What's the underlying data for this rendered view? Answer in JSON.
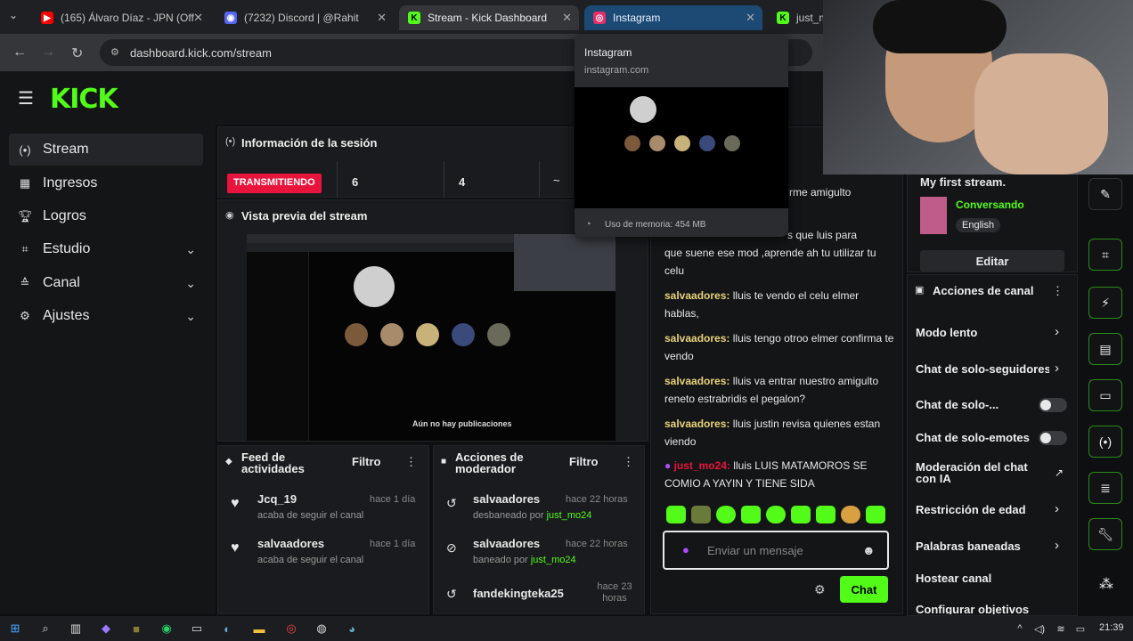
{
  "browser": {
    "tabs": [
      {
        "title": "(165) Álvaro Díaz - JPN (Off",
        "fav_color": "#ff0000"
      },
      {
        "title": "(7232) Discord | @Rahit",
        "fav_color": "#5865f2"
      },
      {
        "title": "Stream - Kick Dashboard",
        "fav_color": "#53fc18",
        "fav_letter": "K"
      },
      {
        "title": "Instagram",
        "fav_color": "#e1306c"
      },
      {
        "title": "just_m",
        "fav_color": "#53fc18",
        "fav_letter": "K"
      }
    ],
    "url": "dashboard.kick.com/stream",
    "hover_card": {
      "title": "Instagram",
      "domain": "instagram.com",
      "memory": "Uso de memoria: 454 MB"
    }
  },
  "header": {
    "logo": "KICK"
  },
  "sidebar": {
    "items": [
      {
        "label": "Stream",
        "icon": "stream-icon"
      },
      {
        "label": "Ingresos",
        "icon": "income-icon"
      },
      {
        "label": "Logros",
        "icon": "trophy-icon"
      },
      {
        "label": "Estudio",
        "icon": "studio-icon"
      },
      {
        "label": "Canal",
        "icon": "channel-icon"
      },
      {
        "label": "Ajustes",
        "icon": "settings-icon"
      }
    ]
  },
  "session": {
    "title": "Información de la sesión",
    "status": "TRANSMITIENDO",
    "stat1": "6",
    "stat2": "4",
    "stat3": "~"
  },
  "preview": {
    "title": "Vista previa del stream",
    "caption": "Aún no hay publicaciones"
  },
  "activity": {
    "title": "Feed de actividades",
    "filter": "Filtro",
    "events": [
      {
        "name": "Jcq_19",
        "sub": "acaba de seguir el canal",
        "time": "hace 1 día"
      },
      {
        "name": "salvaadores",
        "sub": "acaba de seguir el canal",
        "time": "hace 1 día"
      }
    ]
  },
  "moderator": {
    "title": "Acciones de moderador",
    "filter": "Filtro",
    "events": [
      {
        "name": "salvaadores",
        "action": "desbaneado por",
        "by": "just_mo24",
        "time": "hace 22 horas"
      },
      {
        "name": "salvaadores",
        "action": "baneado por",
        "by": "just_mo24",
        "time": "hace 22 horas"
      },
      {
        "name": "fandekingteka25",
        "time": "hace 23 horas"
      }
    ]
  },
  "chat": {
    "partial1": "rme amigulto",
    "partial2": "s que luis para",
    "partial3": "que suene ese mod ,aprende ah tu utilizar tu celu",
    "messages": [
      {
        "user": "salvaadores:",
        "text": "lluis te vendo el celu elmer hablas,"
      },
      {
        "user": "salvaadores:",
        "text": "lluis tengo otroo elmer confirma te vendo"
      },
      {
        "user": "salvaadores:",
        "text": "lluis va entrar nuestro amigulto reneto estrabridis el pegalon?"
      },
      {
        "user": "salvaadores:",
        "text": "lluis justin revisa quienes estan viendo"
      }
    ],
    "mod_msg": {
      "user": "just_mo24:",
      "text": "lluis LUIS MATAMOROS SE COMIO A YAYIN Y TIENE SIDA"
    },
    "placeholder": "Enviar un mensaje",
    "send": "Chat"
  },
  "stream_info": {
    "title": "My first stream.",
    "category": "Conversando",
    "language": "English",
    "edit": "Editar"
  },
  "channel_actions": {
    "title": "Acciones de canal",
    "items": [
      {
        "label": "Modo lento"
      },
      {
        "label": "Chat de solo-seguidores"
      },
      {
        "label": "Chat de solo-..."
      },
      {
        "label": "Chat de solo-emotes"
      },
      {
        "label": "Moderación del chat con IA"
      },
      {
        "label": "Restricción de edad"
      },
      {
        "label": "Palabras baneadas"
      },
      {
        "label": "Hostear canal"
      },
      {
        "label": "Configurar objetivos"
      }
    ]
  },
  "taskbar": {
    "time": "21:39"
  }
}
